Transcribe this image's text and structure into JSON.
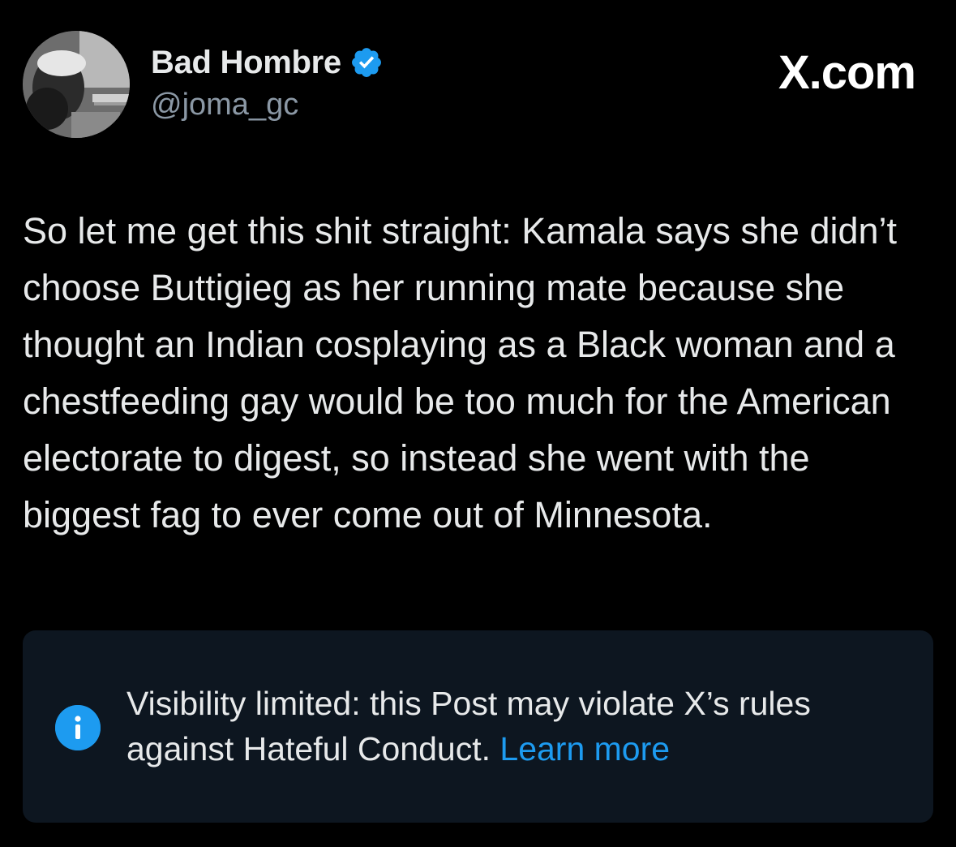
{
  "post": {
    "author": {
      "display_name": "Bad Hombre",
      "handle": "@joma_gc",
      "verified": true,
      "avatar_icon": "avatar-photo",
      "verified_icon": "verified-badge-icon"
    },
    "brand": "X.com",
    "text": "So let me get this shit straight: Kamala says she didn’t choose Buttigieg as her running mate because she thought an Indian cosplaying as a Black woman and a chestfeeding gay would be too much for the American electorate to digest, so instead she went with the biggest fag to ever come out of Minnesota.",
    "notice": {
      "icon": "info-icon",
      "message": "Visibility limited: this Post may violate X’s rules against Hateful Conduct.",
      "link_label": "Learn more"
    }
  },
  "colors": {
    "background": "#000000",
    "text_primary": "#e7e9ea",
    "text_secondary": "#8b98a5",
    "accent": "#1d9bf0",
    "notice_background": "#0d1620"
  }
}
